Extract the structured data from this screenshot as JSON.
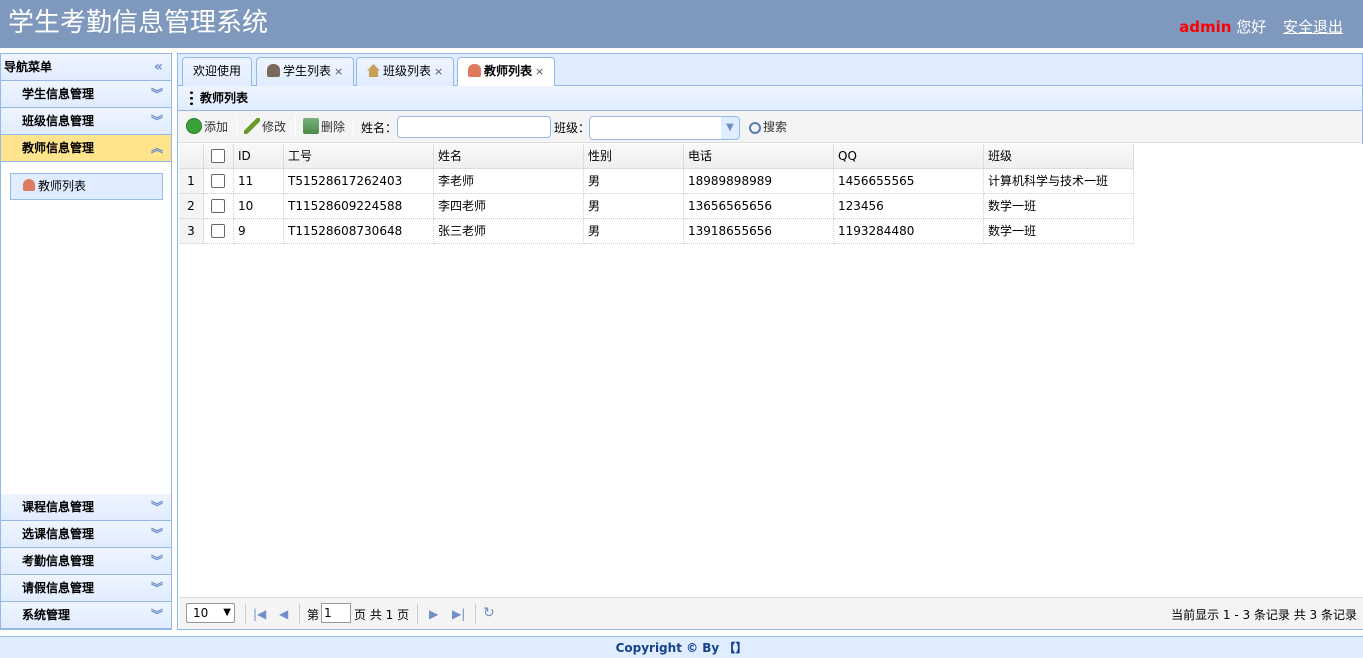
{
  "app": {
    "title": "学生考勤信息管理系统"
  },
  "header": {
    "username": "admin",
    "greeting": "您好",
    "logout": "安全退出"
  },
  "sidebar": {
    "title": "导航菜单",
    "sections_top": [
      {
        "label": "学生信息管理",
        "icon": "chevron-double-down-icon"
      },
      {
        "label": "班级信息管理",
        "icon": "chevron-double-down-icon"
      },
      {
        "label": "教师信息管理",
        "icon": "chevron-double-up-icon",
        "active": true
      }
    ],
    "active_items": [
      {
        "label": "教师列表",
        "icon": "teacher-icon"
      }
    ],
    "sections_bottom": [
      {
        "label": "课程信息管理"
      },
      {
        "label": "选课信息管理"
      },
      {
        "label": "考勤信息管理"
      },
      {
        "label": "请假信息管理"
      },
      {
        "label": "系统管理"
      }
    ]
  },
  "tabs": [
    {
      "label": "欢迎使用",
      "closable": false
    },
    {
      "label": "学生列表",
      "closable": true,
      "icon": "student-icon"
    },
    {
      "label": "班级列表",
      "closable": true,
      "icon": "home-icon"
    },
    {
      "label": "教师列表",
      "closable": true,
      "icon": "teacher-icon",
      "active": true
    }
  ],
  "tab_close_glyph": "×",
  "panel": {
    "title": "教师列表"
  },
  "toolbar": {
    "add": "添加",
    "edit": "修改",
    "delete": "删除",
    "name_label": "姓名：",
    "name_value": "",
    "class_label": "班级：",
    "class_value": "",
    "search": "搜索"
  },
  "grid": {
    "columns": [
      "ID",
      "工号",
      "姓名",
      "性别",
      "电话",
      "QQ",
      "班级"
    ],
    "rows": [
      {
        "num": "1",
        "id": "11",
        "sn": "T51528617262403",
        "name": "李老师",
        "sex": "男",
        "phone": "18989898989",
        "qq": "1456655565",
        "clazz": "计算机科学与技术一班"
      },
      {
        "num": "2",
        "id": "10",
        "sn": "T11528609224588",
        "name": "李四老师",
        "sex": "男",
        "phone": "13656565656",
        "qq": "123456",
        "clazz": "数学一班"
      },
      {
        "num": "3",
        "id": "9",
        "sn": "T11528608730648",
        "name": "张三老师",
        "sex": "男",
        "phone": "13918655656",
        "qq": "1193284480",
        "clazz": "数学一班"
      }
    ]
  },
  "pager": {
    "page_size": "10",
    "page_prefix": "第",
    "page_value": "1",
    "page_suffix": "页 共 1 页",
    "summary": "当前显示 1 - 3 条记录 共 3 条记录"
  },
  "footer": {
    "text": "Copyright © By 【】"
  },
  "colors": {
    "header_bg": "#7f99be",
    "accent": "#95b8e7",
    "active_section": "#ffe48d",
    "admin_red": "#ff0000"
  }
}
